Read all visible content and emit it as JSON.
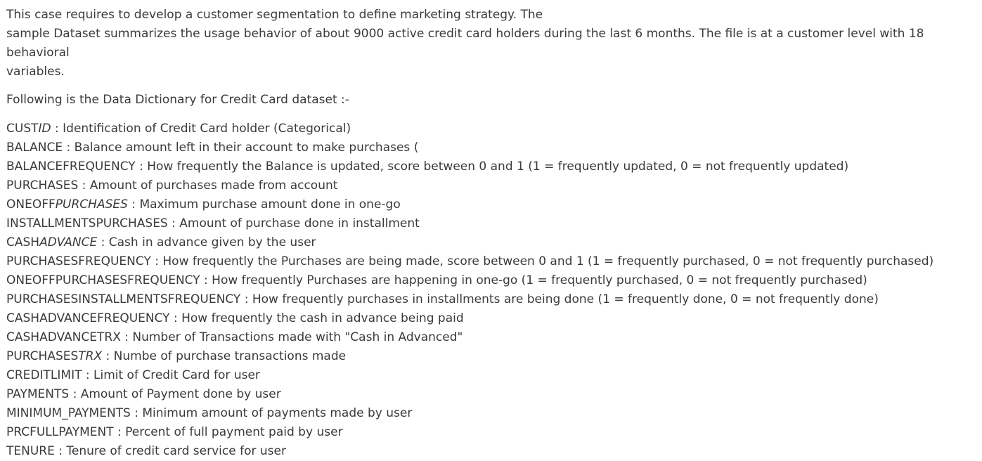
{
  "intro": {
    "line1": "This case requires to develop a customer segmentation to define marketing strategy. The",
    "line2": "sample Dataset summarizes the usage behavior of about 9000 active credit card holders during the last 6 months. The file is at a customer level with 18 behavioral",
    "line3": "variables."
  },
  "heading": "Following is the Data Dictionary for Credit Card dataset :-",
  "dictionary": [
    {
      "term_a": "CUST",
      "term_b": "ID",
      "term_c": "",
      "desc": " : Identification of Credit Card holder (Categorical)"
    },
    {
      "term_a": "BALANCE",
      "term_b": "",
      "term_c": "",
      "desc": " : Balance amount left in their account to make purchases ("
    },
    {
      "term_a": "BALANCEFREQUENCY",
      "term_b": "",
      "term_c": "",
      "desc": " : How frequently the Balance is updated, score between 0 and 1 (1 = frequently updated, 0 = not frequently updated)"
    },
    {
      "term_a": "PURCHASES",
      "term_b": "",
      "term_c": "",
      "desc": " : Amount of purchases made from account"
    },
    {
      "term_a": "ONEOFF",
      "term_b": "PURCHASES",
      "term_c": "",
      "desc": " : Maximum purchase amount done in one-go"
    },
    {
      "term_a": "INSTALLMENTSPURCHASES",
      "term_b": "",
      "term_c": "",
      "desc": " : Amount of purchase done in installment"
    },
    {
      "term_a": "CASH",
      "term_b": "ADVANCE",
      "term_c": "",
      "desc": " : Cash in advance given by the user"
    },
    {
      "term_a": "PURCHASESFREQUENCY",
      "term_b": "",
      "term_c": "",
      "desc": " : How frequently the Purchases are being made, score between 0 and 1 (1 = frequently purchased, 0 = not frequently purchased)"
    },
    {
      "term_a": "ONEOFFPURCHASESFREQUENCY",
      "term_b": "",
      "term_c": "",
      "desc": " : How frequently Purchases are happening in one-go (1 = frequently purchased, 0 = not frequently purchased)"
    },
    {
      "term_a": "PURCHASESINSTALLMENTSFREQUENCY",
      "term_b": "",
      "term_c": "",
      "desc": " : How frequently purchases in installments are being done (1 = frequently done, 0 = not frequently done)"
    },
    {
      "term_a": "CASHADVANCEFREQUENCY",
      "term_b": "",
      "term_c": "",
      "desc": " : How frequently the cash in advance being paid"
    },
    {
      "term_a": "CASHADVANCETRX",
      "term_b": "",
      "term_c": "",
      "desc": " : Number of Transactions made with \"Cash in Advanced\""
    },
    {
      "term_a": "PURCHASES",
      "term_b": "TRX",
      "term_c": "",
      "desc": " : Numbe of purchase transactions made"
    },
    {
      "term_a": "CREDITLIMIT",
      "term_b": "",
      "term_c": "",
      "desc": " : Limit of Credit Card for user"
    },
    {
      "term_a": "PAYMENTS",
      "term_b": "",
      "term_c": "",
      "desc": " : Amount of Payment done by user"
    },
    {
      "term_a": "MINIMUM_PAYMENTS",
      "term_b": "",
      "term_c": "",
      "desc": " : Minimum amount of payments made by user"
    },
    {
      "term_a": "PRCFULLPAYMENT",
      "term_b": "",
      "term_c": "",
      "desc": " : Percent of full payment paid by user"
    },
    {
      "term_a": "TENURE",
      "term_b": "",
      "term_c": "",
      "desc": " : Tenure of credit card service for user"
    }
  ]
}
